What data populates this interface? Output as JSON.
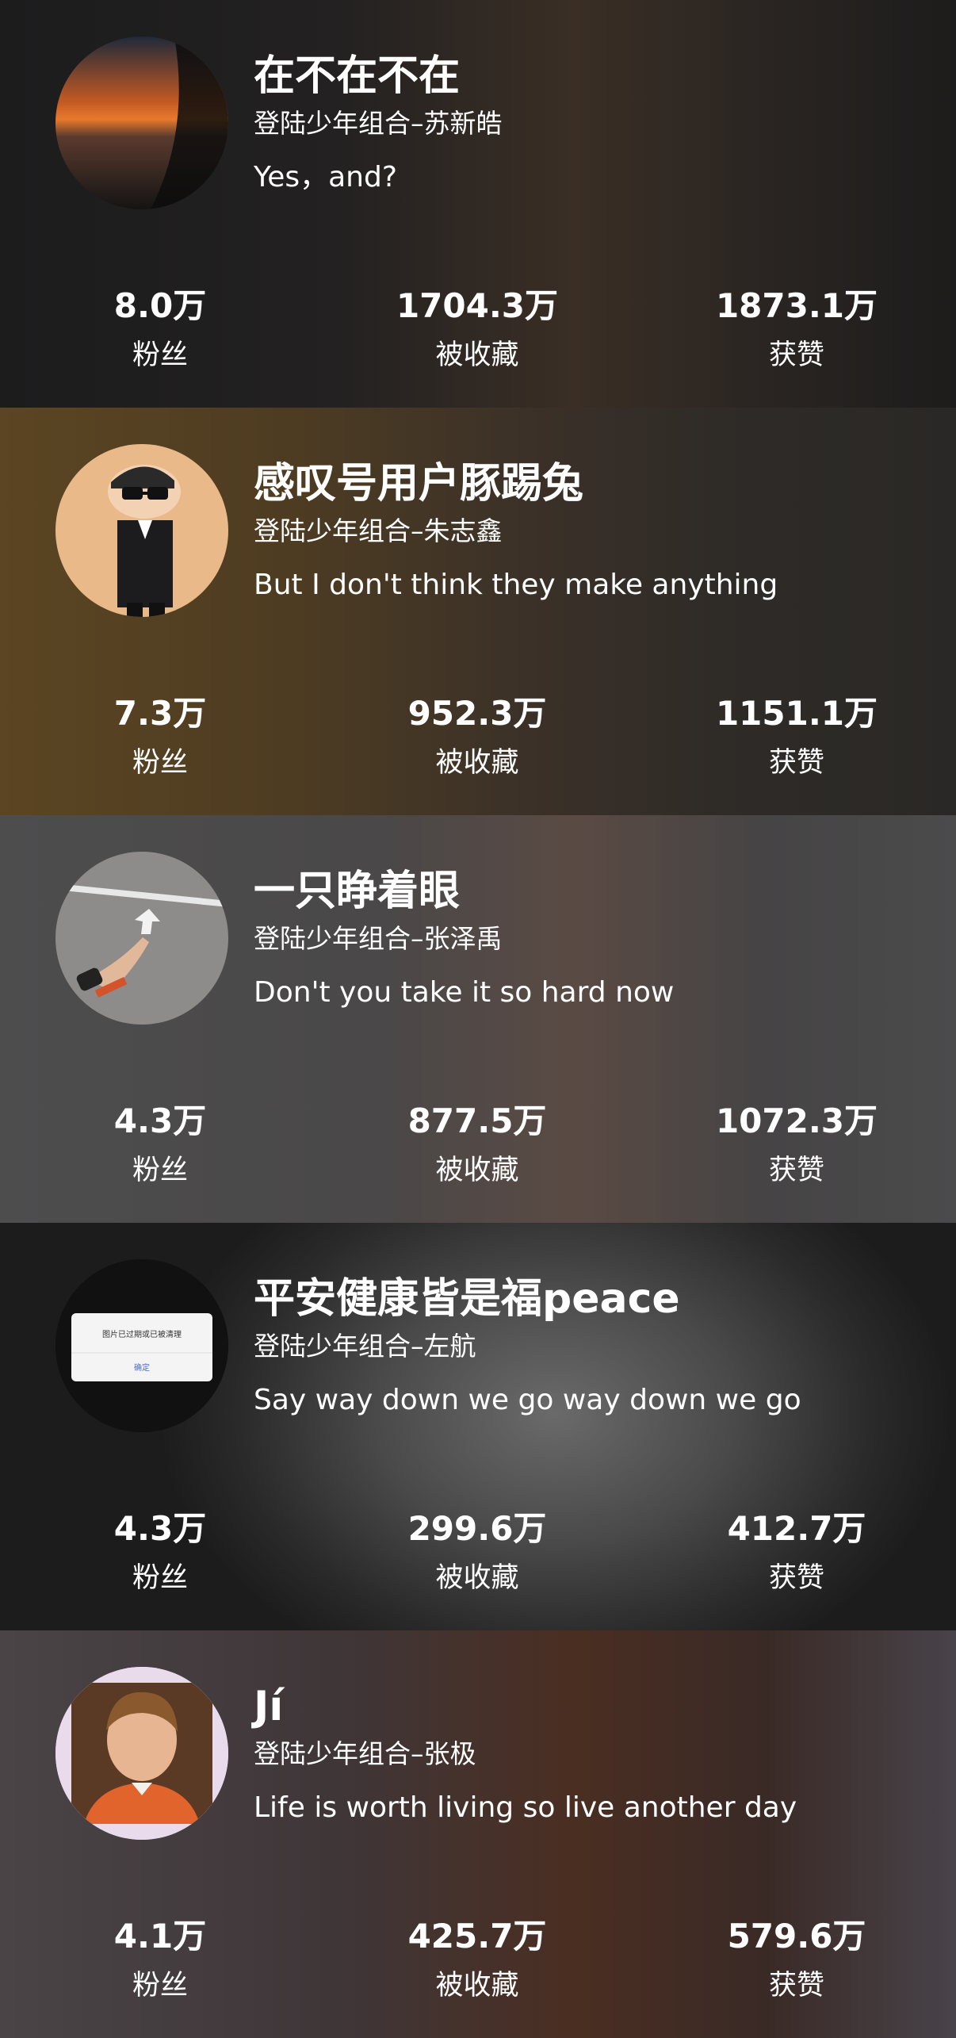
{
  "profiles": [
    {
      "nickname": "在不在不在",
      "group": "登陆少年组合–苏新皓",
      "signature": "Yes，and?",
      "avatar": "sunset-sky-photo",
      "stats": [
        {
          "value": "8.0万",
          "label": "粉丝"
        },
        {
          "value": "1704.3万",
          "label": "被收藏"
        },
        {
          "value": "1873.1万",
          "label": "获赞"
        }
      ]
    },
    {
      "nickname": "感叹号用户豚踢兔",
      "group": "登陆少年组合–朱志鑫",
      "signature": "But I don't think they make anything",
      "avatar": "cartoon-character-in-suit-and-sunglasses",
      "stats": [
        {
          "value": "7.3万",
          "label": "粉丝"
        },
        {
          "value": "952.3万",
          "label": "被收藏"
        },
        {
          "value": "1151.1万",
          "label": "获赞"
        }
      ]
    },
    {
      "nickname": "一只睁着眼",
      "group": "登陆少年组合–张泽禹",
      "signature": "Don't you take it so hard now",
      "avatar": "hand-pointing-at-road-arrow",
      "stats": [
        {
          "value": "4.3万",
          "label": "粉丝"
        },
        {
          "value": "877.5万",
          "label": "被收藏"
        },
        {
          "value": "1072.3万",
          "label": "获赞"
        }
      ]
    },
    {
      "nickname": "平安健康皆是福peace",
      "group": "登陆少年组合–左航",
      "signature": "Say way down we go  way down we go",
      "avatar": "expired-image-dialog-screenshot",
      "avatar_text": "图片已过期或已被清理",
      "avatar_button": "确定",
      "stats": [
        {
          "value": "4.3万",
          "label": "粉丝"
        },
        {
          "value": "299.6万",
          "label": "被收藏"
        },
        {
          "value": "412.7万",
          "label": "获赞"
        }
      ]
    },
    {
      "nickname": "Jí",
      "group": "登陆少年组合–张极",
      "signature": "Life is worth living so live another day",
      "avatar": "portrait-of-smiling-boy",
      "stats": [
        {
          "value": "4.1万",
          "label": "粉丝"
        },
        {
          "value": "425.7万",
          "label": "被收藏"
        },
        {
          "value": "579.6万",
          "label": "获赞"
        }
      ]
    }
  ]
}
